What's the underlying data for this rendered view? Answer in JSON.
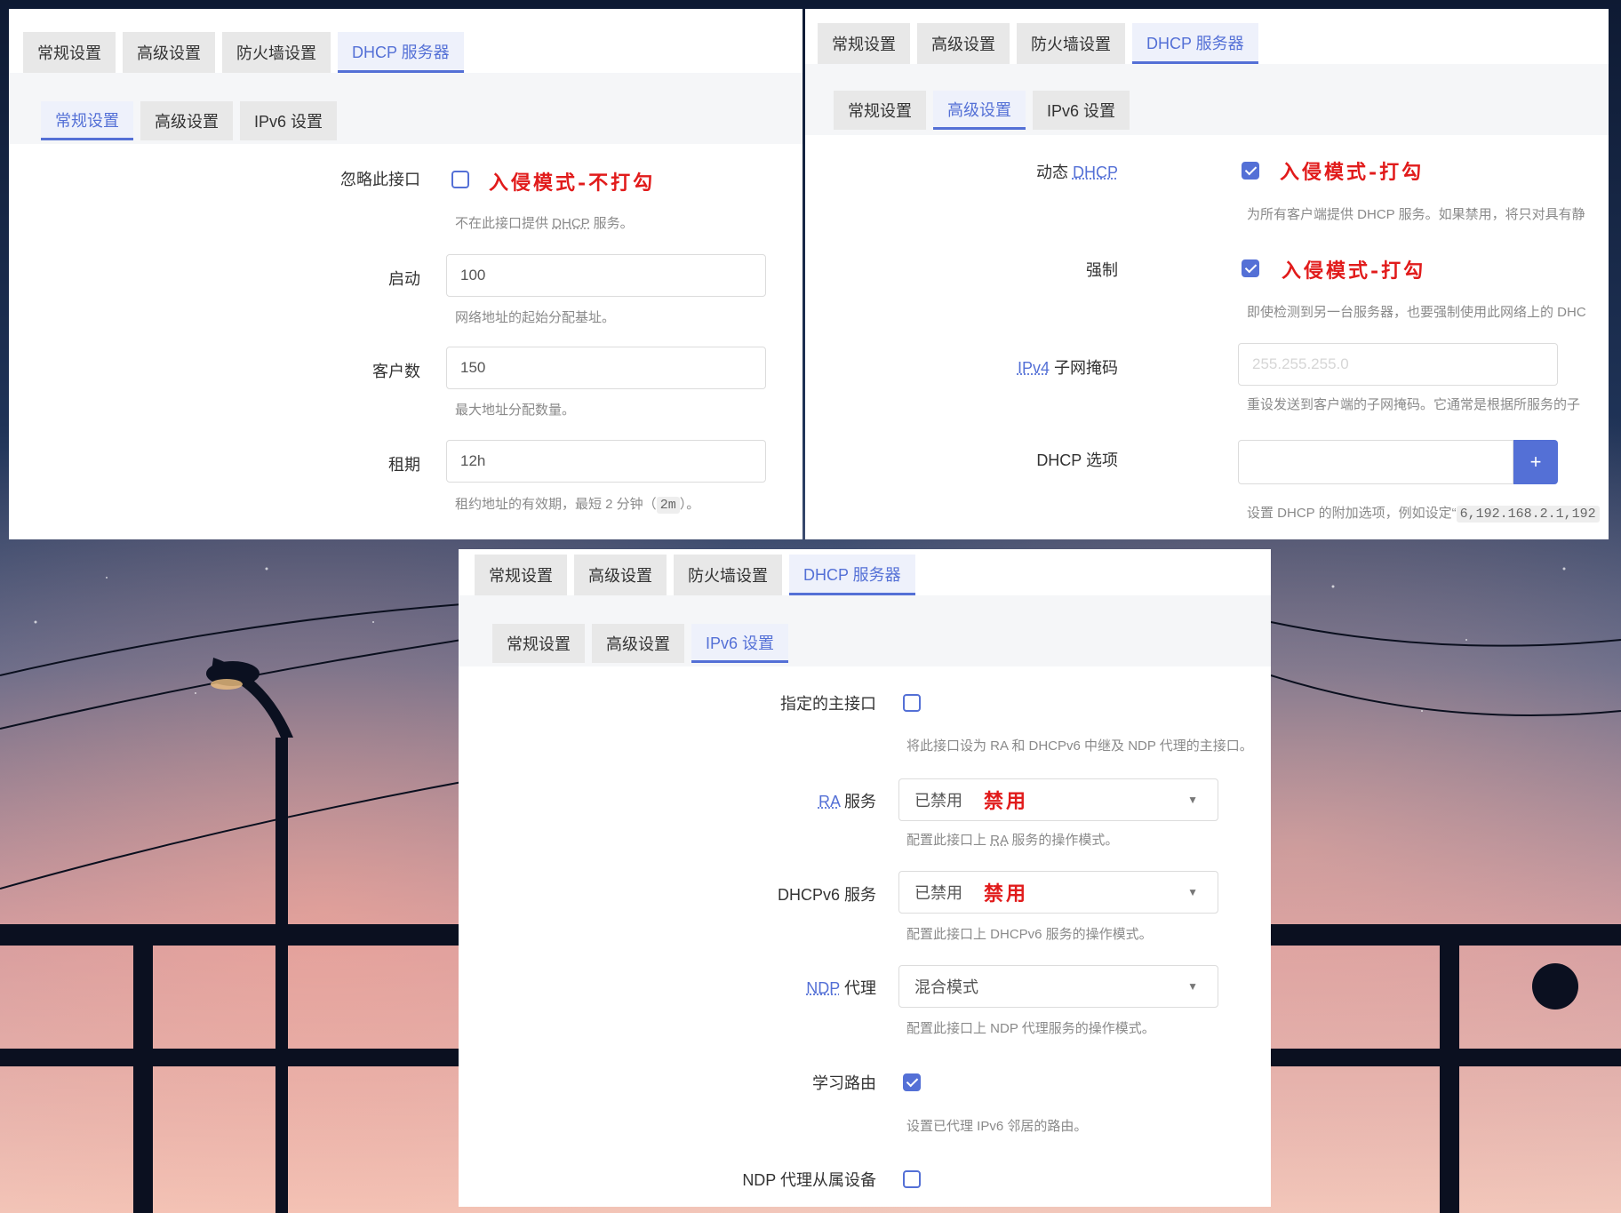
{
  "main_tabs": [
    "常规设置",
    "高级设置",
    "防火墙设置",
    "DHCP 服务器"
  ],
  "sub_tabs": [
    "常规设置",
    "高级设置",
    "IPv6 设置"
  ],
  "panel_general": {
    "ignore_label": "忽略此接口",
    "ignore_note": "入侵模式-不打勾",
    "ignore_hint_pre": "不在此接口提供 ",
    "ignore_hint_abbr": "DHCP",
    "ignore_hint_post": " 服务。",
    "start_label": "启动",
    "start_value": "100",
    "start_hint": "网络地址的起始分配基址。",
    "limit_label": "客户数",
    "limit_value": "150",
    "limit_hint": "最大地址分配数量。",
    "lease_label": "租期",
    "lease_value": "12h",
    "lease_hint_pre": "租约地址的有效期，最短 2 分钟（",
    "lease_hint_code": "2m",
    "lease_hint_post": "）。"
  },
  "panel_advanced": {
    "dynamic_label_pre": "动态 ",
    "dynamic_label_abbr": "DHCP",
    "dynamic_note": "入侵模式-打勾",
    "dynamic_hint": "为所有客户端提供 DHCP 服务。如果禁用，将只对具有静",
    "force_label": "强制",
    "force_note": "入侵模式-打勾",
    "force_hint": "即使检测到另一台服务器，也要强制使用此网络上的 DHC",
    "netmask_label_abbr": "IPv4",
    "netmask_label_post": " 子网掩码",
    "netmask_placeholder": "255.255.255.0",
    "netmask_hint": "重设发送到客户端的子网掩码。它通常是根据所服务的子",
    "options_label": "DHCP 选项",
    "options_add": "+",
    "options_hint_pre": "设置 DHCP 的附加选项，例如设定“",
    "options_hint_code": "6,192.168.2.1,192"
  },
  "panel_ipv6": {
    "master_label": "指定的主接口",
    "master_hint": "将此接口设为 RA 和 DHCPv6 中继及 NDP 代理的主接口。",
    "ra_label_abbr": "RA",
    "ra_label_post": " 服务",
    "ra_value": "已禁用",
    "ra_note": "禁用",
    "ra_hint_pre": "配置此接口上 ",
    "ra_hint_abbr": "RA",
    "ra_hint_post": " 服务的操作模式。",
    "dhcpv6_label": "DHCPv6 服务",
    "dhcpv6_value": "已禁用",
    "dhcpv6_note": "禁用",
    "dhcpv6_hint": "配置此接口上 DHCPv6 服务的操作模式。",
    "ndp_label_abbr": "NDP",
    "ndp_label_post": " 代理",
    "ndp_value": "混合模式",
    "ndp_hint": "配置此接口上 NDP 代理服务的操作模式。",
    "learn_label": "学习路由",
    "learn_hint": "设置已代理 IPv6 邻居的路由。",
    "slave_label": "NDP 代理从属设备"
  },
  "colors": {
    "accent": "#5470d6",
    "annotation": "#e11b1b"
  }
}
